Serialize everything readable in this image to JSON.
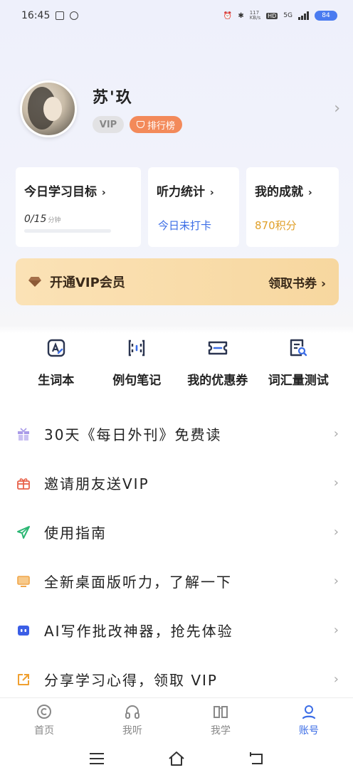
{
  "status_bar": {
    "time": "16:45",
    "net_speed": "117\nKB/s",
    "hd": "HD",
    "network": "5G",
    "battery": "84"
  },
  "profile": {
    "username": "苏'玖",
    "vip_label": "VIP",
    "rank_label": "排行榜"
  },
  "cards": {
    "study_goal": {
      "title": "今日学习目标",
      "progress_value": "0/15",
      "progress_unit": "分钟",
      "progress_fraction": 0
    },
    "listening": {
      "title": "听力统计",
      "status": "今日未打卡"
    },
    "achievement": {
      "title": "我的成就",
      "points": "870积分"
    }
  },
  "vip_banner": {
    "title": "开通VIP会员",
    "action": "领取书券 ›"
  },
  "tools": [
    {
      "label": "生词本",
      "icon": "vocabulary-book-icon"
    },
    {
      "label": "例句笔记",
      "icon": "sentence-notes-icon"
    },
    {
      "label": "我的优惠券",
      "icon": "coupon-icon"
    },
    {
      "label": "词汇量测试",
      "icon": "vocab-test-icon"
    }
  ],
  "menu": [
    {
      "label": "30天《每日外刊》免费读",
      "icon": "gift-box-icon",
      "color": "#a99be8"
    },
    {
      "label": "邀请朋友送VIP",
      "icon": "gift-icon",
      "color": "#e8624a"
    },
    {
      "label": "使用指南",
      "icon": "paper-plane-icon",
      "color": "#2bb673"
    },
    {
      "label": "全新桌面版听力，了解一下",
      "icon": "desktop-icon",
      "color": "#f0a64a"
    },
    {
      "label": "AI写作批改神器，抢先体验",
      "icon": "ai-robot-icon",
      "color": "#3b5ee6"
    },
    {
      "label": "分享学习心得，领取 VIP",
      "icon": "share-icon",
      "color": "#f0a030"
    }
  ],
  "bottom_nav": [
    {
      "label": "首页",
      "icon": "home-icon",
      "active": false
    },
    {
      "label": "我听",
      "icon": "headphones-icon",
      "active": false
    },
    {
      "label": "我学",
      "icon": "book-icon",
      "active": false
    },
    {
      "label": "账号",
      "icon": "account-icon",
      "active": true
    }
  ],
  "colors": {
    "accent": "#3b6de6",
    "rank_badge": "#f38a5a",
    "points": "#e0a02a",
    "vip_banner": "#f7d79f"
  }
}
